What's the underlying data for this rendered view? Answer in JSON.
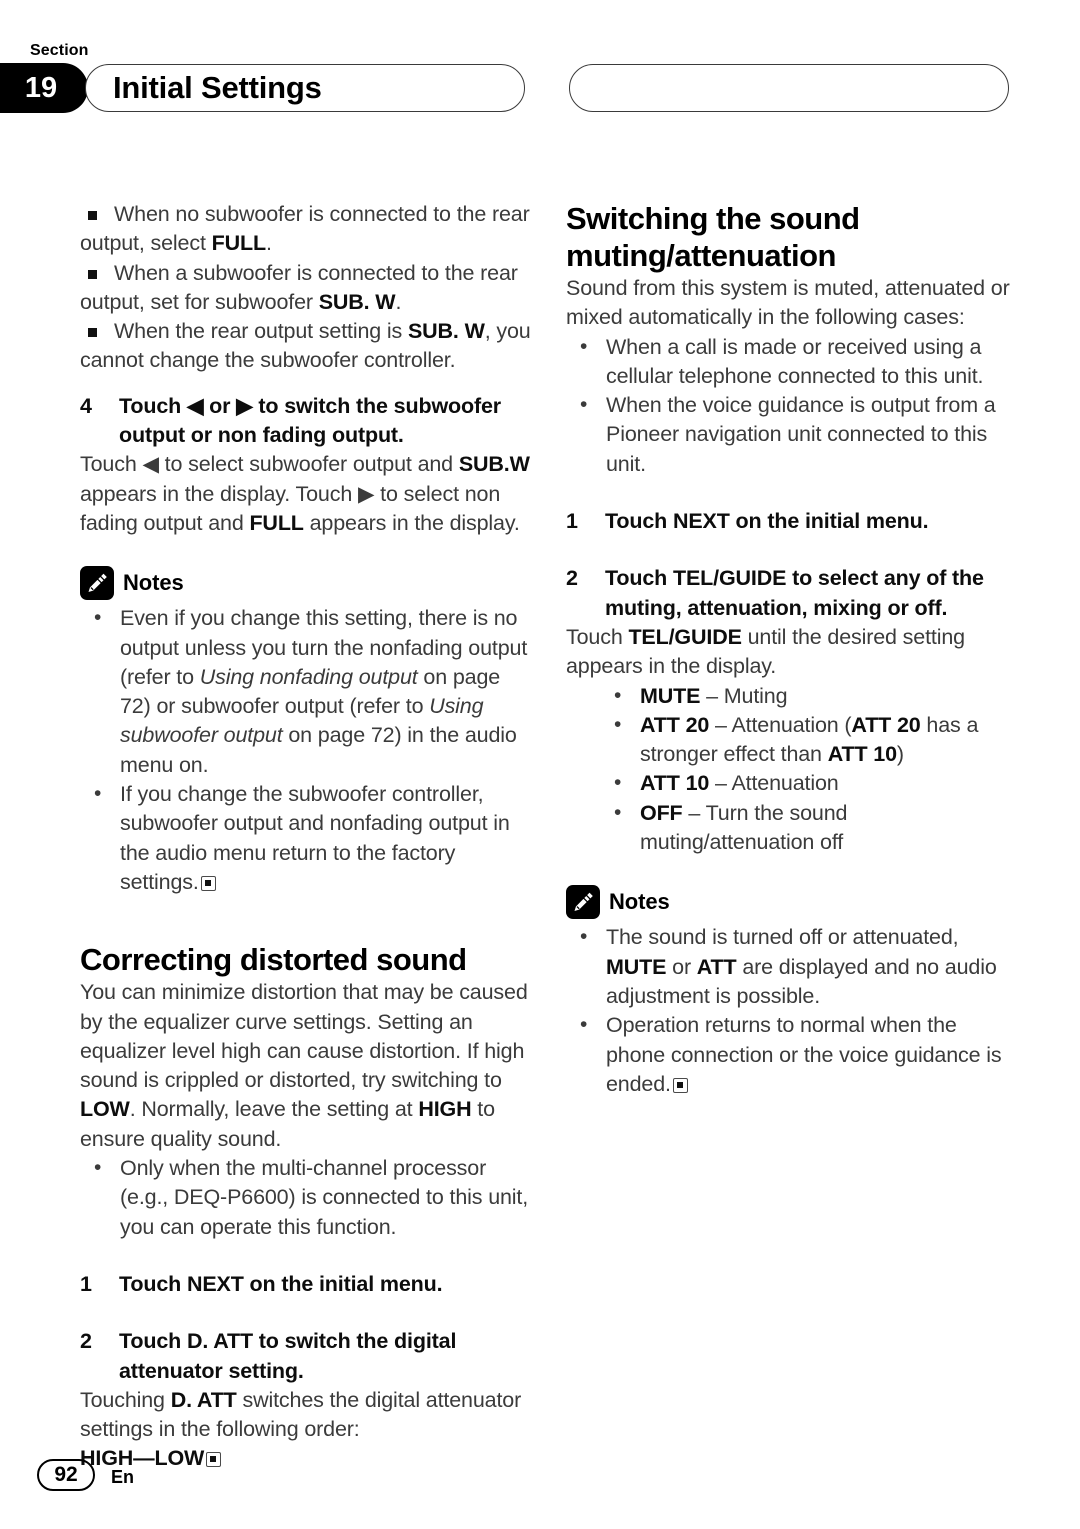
{
  "header": {
    "section_label": "Section",
    "section_number": "19",
    "title": "Initial Settings"
  },
  "left_column": {
    "square_bullets": [
      "When no subwoofer is connected to the rear output, select FULL.",
      "When a subwoofer is connected to the rear output, set for subwoofer SUB. W.",
      "When the rear output setting is SUB. W, you cannot change the subwoofer controller."
    ],
    "step4": {
      "number": "4",
      "heading": "Touch ◀ or ▶ to switch the subwoofer output or non fading output.",
      "body": "Touch ◀ to select subwoofer output and SUB.W appears in the display. Touch ▶ to select non fading output and FULL appears in the display."
    },
    "notes": {
      "title": "Notes",
      "icon": "pencil-icon",
      "items": [
        "Even if you change this setting, there is no output unless you turn the nonfading output (refer to Using nonfading output on page 72) or subwoofer output (refer to Using subwoofer output on page 72) in the audio menu on.",
        "If you change the subwoofer controller, subwoofer output and nonfading output in the audio menu return to the factory settings."
      ]
    },
    "heading2": "Correcting distorted sound",
    "intro": "You can minimize distortion that may be caused by the equalizer curve settings. Setting an equalizer level high can cause distortion. If high sound is crippled or distorted, try switching to LOW. Normally, leave the setting at HIGH to ensure quality sound.",
    "bullet": "Only when the multi-channel processor (e.g., DEQ-P6600) is connected to this unit, you can operate this function.",
    "step1": {
      "number": "1",
      "heading": "Touch NEXT on the initial menu."
    },
    "step2": {
      "number": "2",
      "heading": "Touch D. ATT to switch the digital attenuator setting.",
      "body": "Touching D. ATT switches the digital attenuator settings in the following order:",
      "order": "HIGH—LOW"
    }
  },
  "right_column": {
    "heading1_line1": "Switching the sound",
    "heading1_line2": "muting/attenuation",
    "intro": "Sound from this system is muted, attenuated or mixed automatically in the following cases:",
    "cases": [
      "When a call is made or received using a cellular telephone connected to this unit.",
      "When the voice guidance is output from a Pioneer navigation unit connected to this unit."
    ],
    "step1": {
      "number": "1",
      "heading": "Touch NEXT on the initial menu."
    },
    "step2": {
      "number": "2",
      "heading": "Touch TEL/GUIDE to select any of the muting, attenuation, mixing or off.",
      "body": "Touch TEL/GUIDE until the desired setting appears in the display."
    },
    "options": [
      {
        "term": "MUTE",
        "desc": " – Muting"
      },
      {
        "term": "ATT 20",
        "desc": " – Attenuation (ATT 20 has a stronger effect than ATT 10)"
      },
      {
        "term": "ATT 10",
        "desc": " – Attenuation"
      },
      {
        "term": "OFF",
        "desc": " – Turn the sound muting/attenuation off"
      }
    ],
    "notes": {
      "title": "Notes",
      "icon": "pencil-icon",
      "items": [
        "The sound is turned off or attenuated, MUTE or ATT are displayed and no audio adjustment is possible.",
        "Operation returns to normal when the phone connection or the voice guidance is ended."
      ]
    }
  },
  "footer": {
    "page_number": "92",
    "language": "En"
  }
}
